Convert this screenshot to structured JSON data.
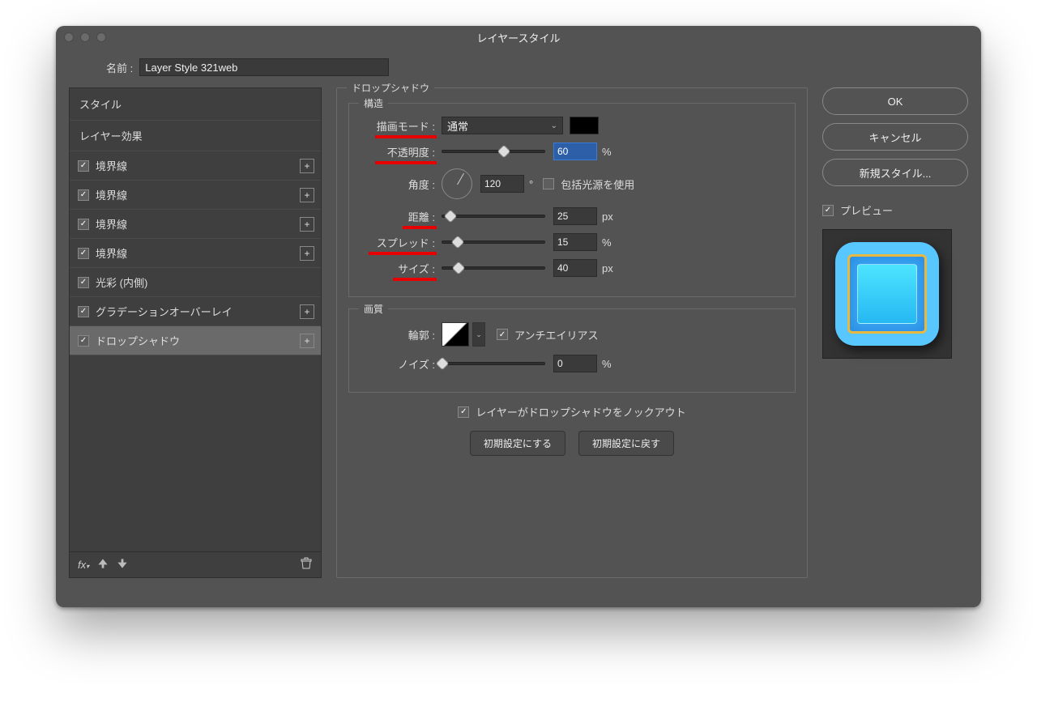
{
  "window": {
    "title": "レイヤースタイル"
  },
  "name": {
    "label": "名前 :",
    "value": "Layer Style 321web"
  },
  "sidebar": {
    "header": "スタイル",
    "subheader": "レイヤー効果",
    "items": [
      {
        "label": "境界線",
        "checked": true,
        "plus": true
      },
      {
        "label": "境界線",
        "checked": true,
        "plus": true
      },
      {
        "label": "境界線",
        "checked": true,
        "plus": true
      },
      {
        "label": "境界線",
        "checked": true,
        "plus": true
      },
      {
        "label": "光彩 (内側)",
        "checked": true,
        "plus": false
      },
      {
        "label": "グラデーションオーバーレイ",
        "checked": true,
        "plus": true
      },
      {
        "label": "ドロップシャドウ",
        "checked": true,
        "plus": true,
        "selected": true
      }
    ]
  },
  "panel": {
    "title": "ドロップシャドウ",
    "struct_title": "構造",
    "blend_label": "描画モード :",
    "blend_value": "通常",
    "opacity_label": "不透明度 :",
    "opacity_value": "60",
    "opacity_unit": "%",
    "angle_label": "角度 :",
    "angle_value": "120",
    "angle_unit": "°",
    "global_light": "包括光源を使用",
    "distance_label": "距離 :",
    "distance_value": "25",
    "distance_unit": "px",
    "spread_label": "スプレッド :",
    "spread_value": "15",
    "spread_unit": "%",
    "size_label": "サイズ :",
    "size_value": "40",
    "size_unit": "px",
    "quality_title": "画質",
    "contour_label": "輪郭 :",
    "aa_label": "アンチエイリアス",
    "noise_label": "ノイズ :",
    "noise_value": "0",
    "noise_unit": "%",
    "knockout_label": "レイヤーがドロップシャドウをノックアウト",
    "make_default": "初期設定にする",
    "reset_default": "初期設定に戻す"
  },
  "buttons": {
    "ok": "OK",
    "cancel": "キャンセル",
    "new_style": "新規スタイル...",
    "preview": "プレビュー"
  }
}
